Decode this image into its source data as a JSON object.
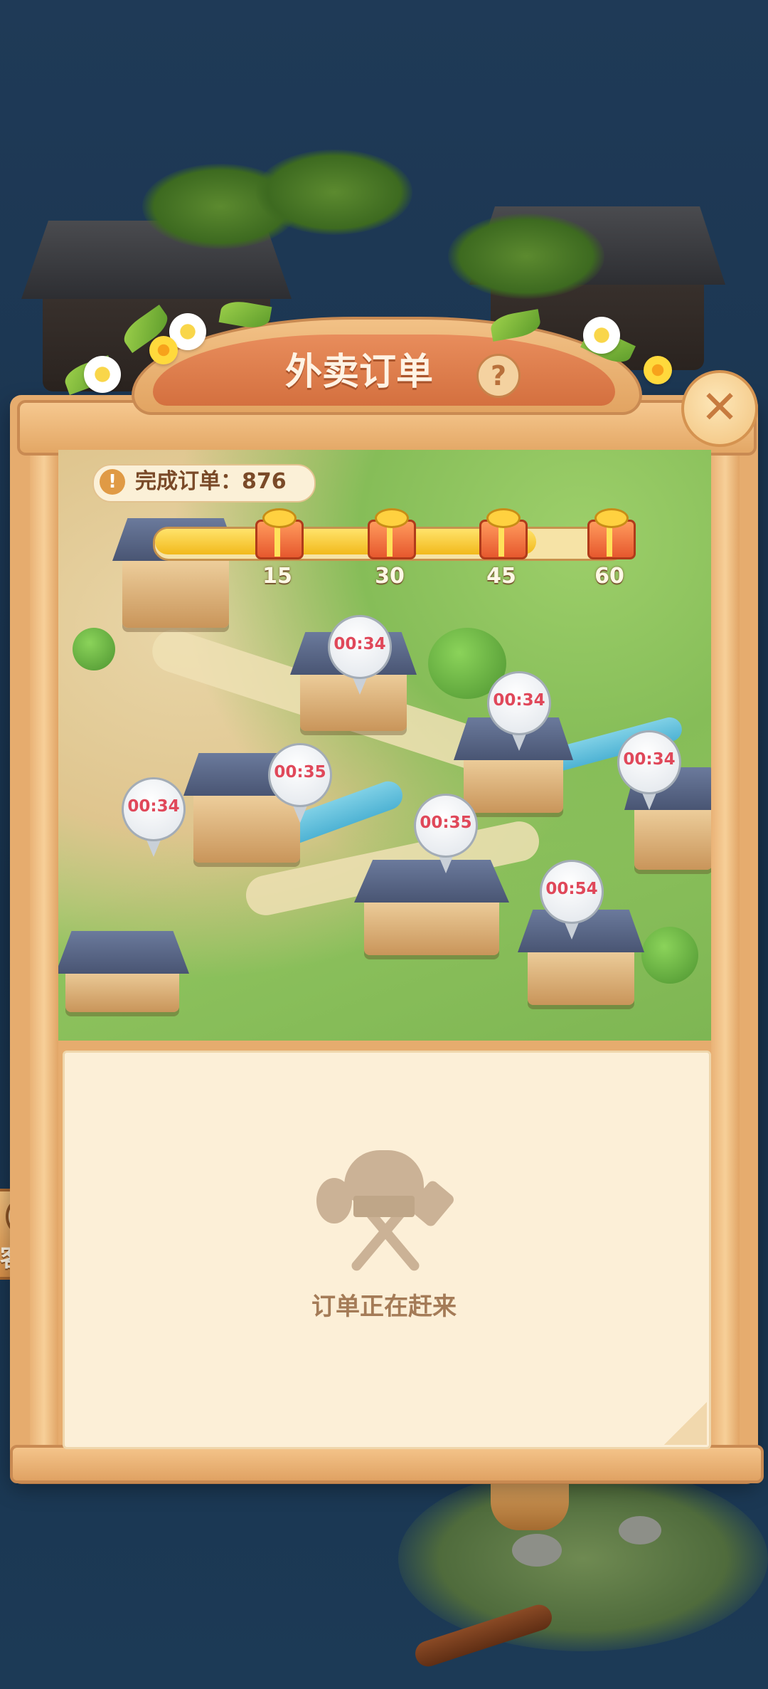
{
  "header": {
    "title": "外卖订单",
    "help_symbol": "?",
    "close_symbol": "✕"
  },
  "stats": {
    "completed_label": "完成订单：",
    "completed_count": "876",
    "alert_symbol": "!"
  },
  "progress": {
    "fill_fraction": 0.82,
    "milestones": [
      {
        "label": "15"
      },
      {
        "label": "30"
      },
      {
        "label": "45"
      },
      {
        "label": "60"
      }
    ]
  },
  "map_pins": [
    {
      "time": "00:34"
    },
    {
      "time": "00:34"
    },
    {
      "time": "00:34"
    },
    {
      "time": "00:35"
    },
    {
      "time": "00:34"
    },
    {
      "time": "00:35"
    },
    {
      "time": "00:54"
    }
  ],
  "orders": {
    "empty_text": "订单正在赶来"
  },
  "side_button": {
    "label": "客服"
  },
  "colors": {
    "panel": "#e6ac6e",
    "header": "#d4703f",
    "paper": "#fcefd7",
    "pin_text": "#e0485a",
    "progress_fill": "#f2b91c"
  }
}
